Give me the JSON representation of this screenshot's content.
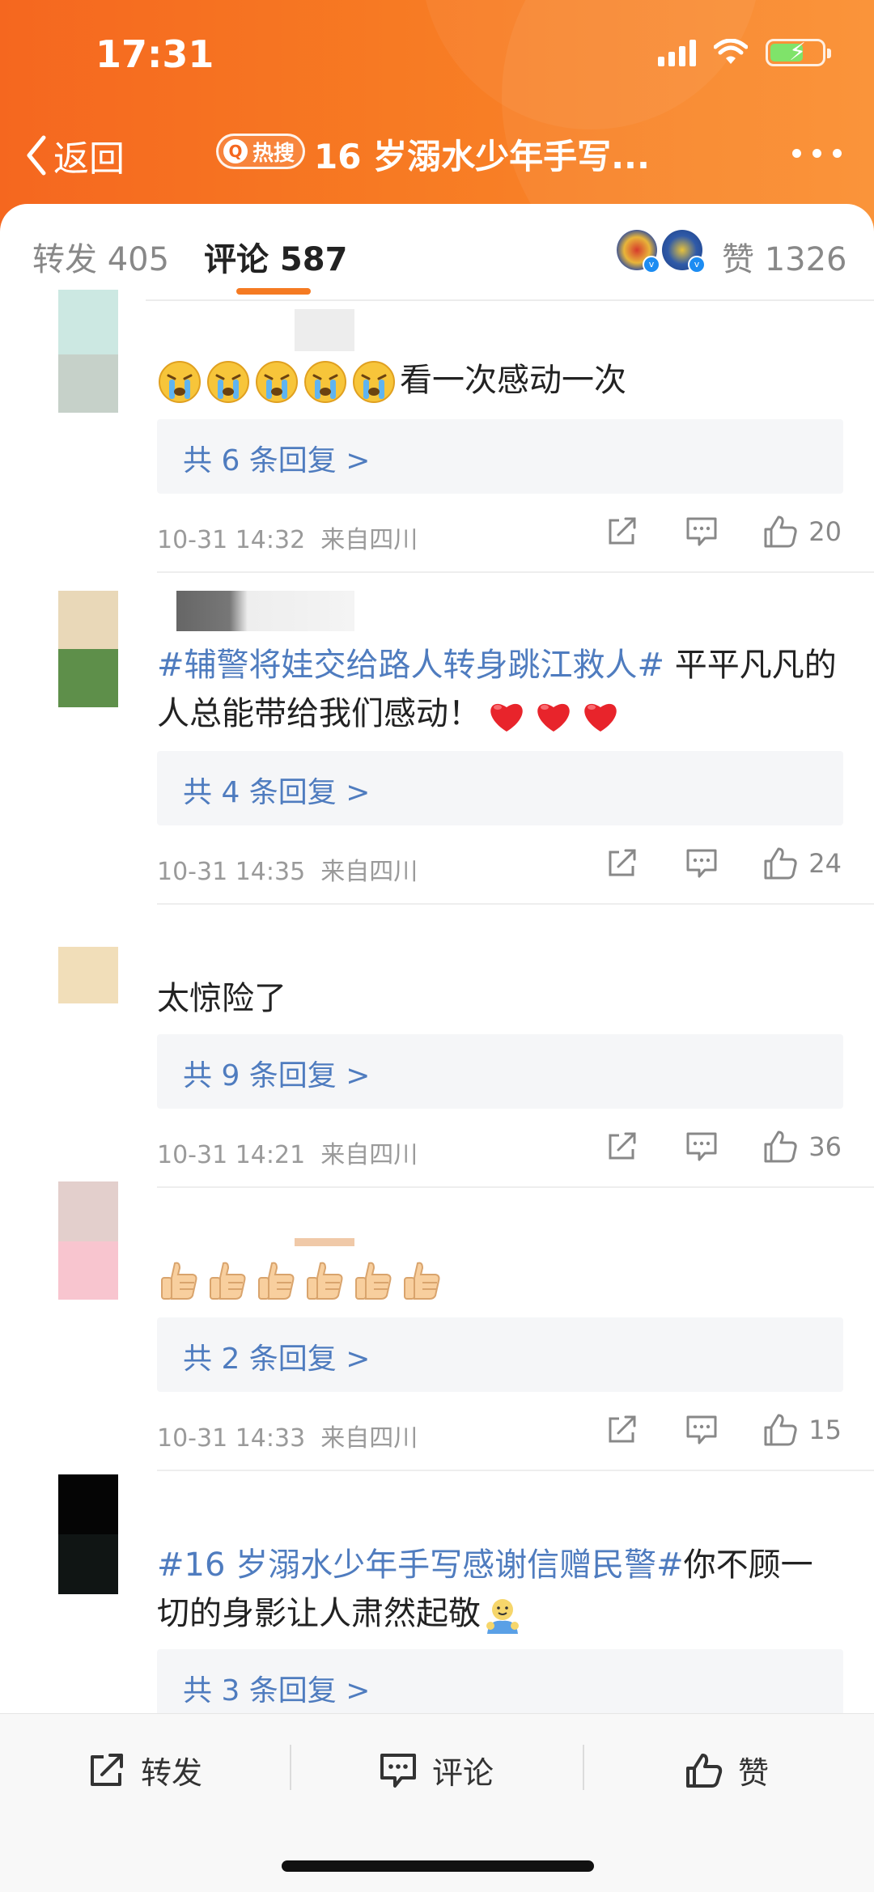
{
  "status": {
    "time": "17:31"
  },
  "header": {
    "back_label": "返回",
    "hot_badge": "热搜",
    "title": "16 岁溺水少年手写..."
  },
  "tabs": {
    "repost": "转发 405",
    "comments": "评论 587",
    "likes": "赞 1326"
  },
  "comments": [
    {
      "text": "看一次感动一次",
      "emoji_count": 5,
      "emoji_name": "crying-emoji",
      "replies": "共 6 条回复 >",
      "time": "10-31 14:32",
      "source": "来自四川",
      "likes": "20"
    },
    {
      "topic": "#辅警将娃交给路人转身跳江救人#",
      "text": " 平平凡凡的人总能带给我们感动！",
      "emoji_count": 3,
      "emoji_name": "heart-emoji",
      "replies": "共 4 条回复 >",
      "time": "10-31 14:35",
      "source": "来自四川",
      "likes": "24"
    },
    {
      "text": "太惊险了",
      "replies": "共 9 条回复 >",
      "time": "10-31 14:21",
      "source": "来自四川",
      "likes": "36"
    },
    {
      "emoji_count": 6,
      "emoji_name": "thumbs-up-emoji",
      "replies": "共 2 条回复 >",
      "time": "10-31 14:33",
      "source": "来自四川",
      "likes": "15"
    },
    {
      "topic": "#16 岁溺水少年手写感谢信赠民警#",
      "text": "你不顾一切的身影让人肃然起敬",
      "emoji_name": "hug-emoji",
      "replies": "共 3 条回复 >"
    }
  ],
  "bottom_bar": {
    "repost": "转发",
    "comment": "评论",
    "like": "赞"
  },
  "colors": {
    "header_orange": "#f5671f",
    "topic_blue": "#4f7cbf",
    "tab_underline": "#f57a22"
  }
}
